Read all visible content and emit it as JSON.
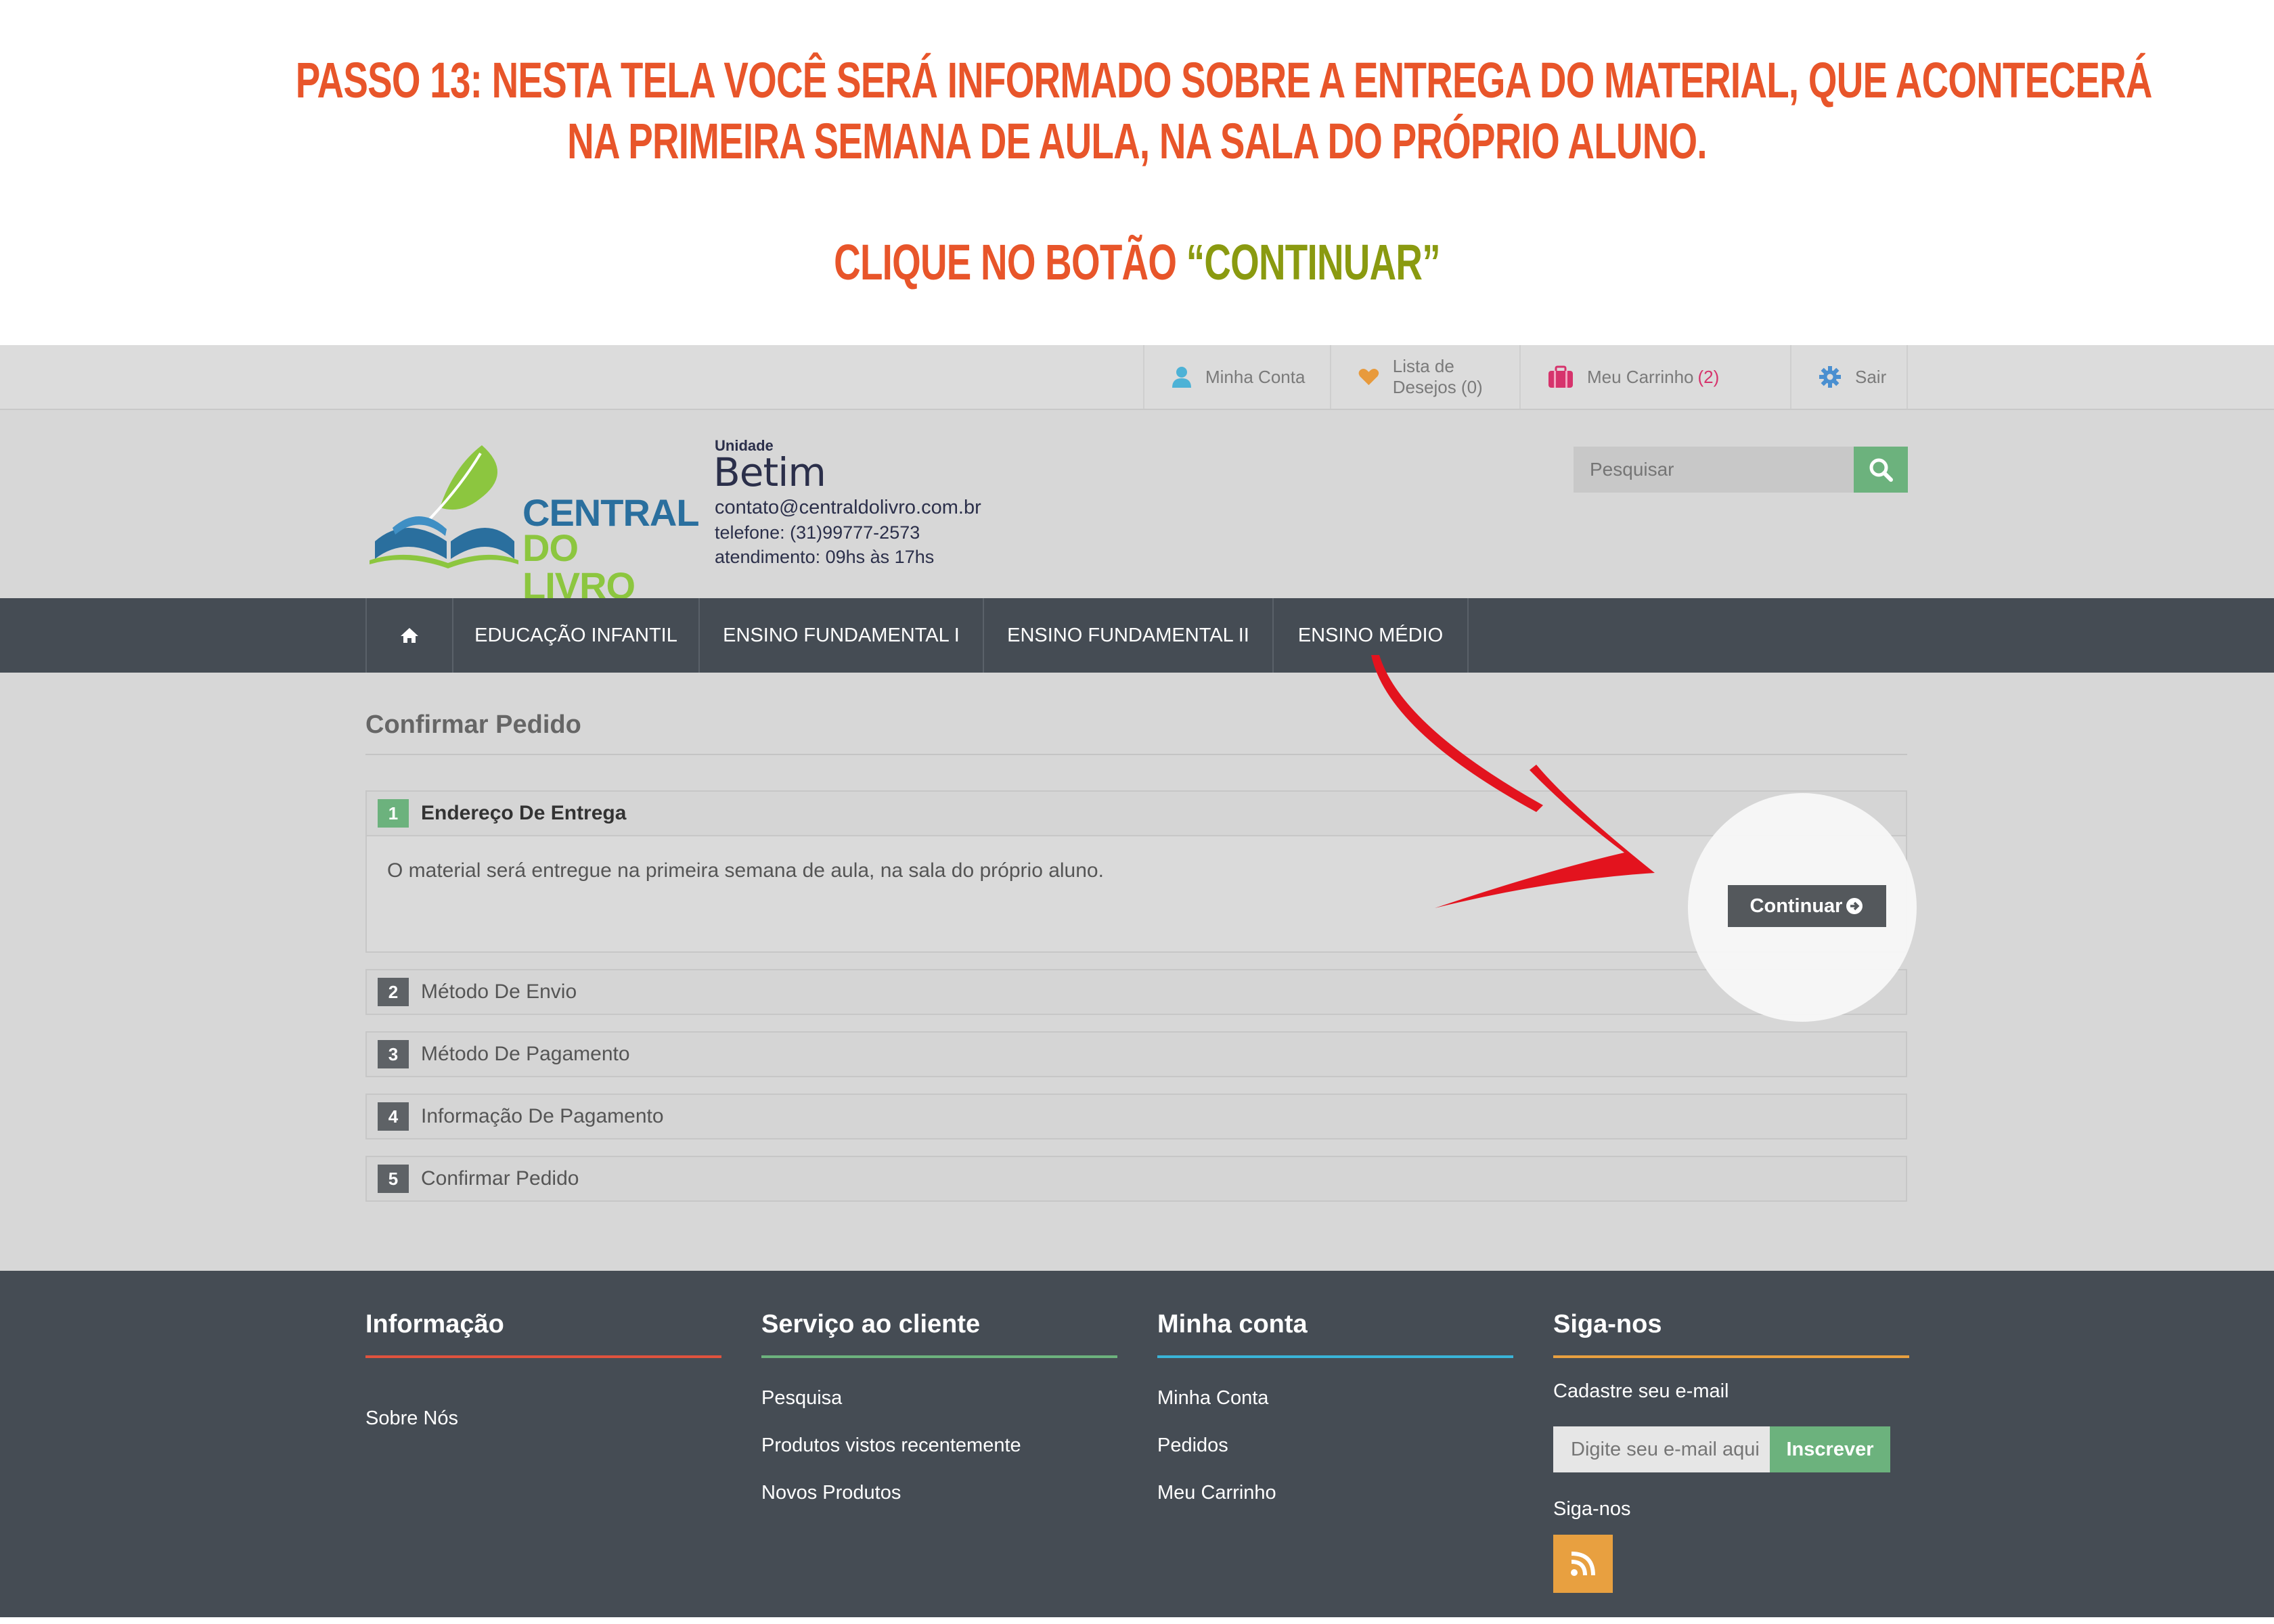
{
  "banner": {
    "line1": "PASSO 13: NESTA TELA VOCÊ SERÁ INFORMADO SOBRE A ENTREGA DO MATERIAL, QUE ACONTECERÁ",
    "line2": "NA PRIMEIRA SEMANA DE AULA, NA SALA DO PRÓPRIO ALUNO.",
    "line3_prefix": "CLIQUE NO BOTÃO ",
    "line3_highlight": "“CONTINUAR”"
  },
  "topbar": {
    "account": "Minha Conta",
    "wishlist": "Lista de Desejos (0)",
    "cart": "Meu Carrinho",
    "cart_count": "(2)",
    "logout": "Sair"
  },
  "logo": {
    "line1": "CENTRAL",
    "line2": "DO LIVRO"
  },
  "store": {
    "unit_label": "Unidade",
    "unit_name": "Betim",
    "email": "contato@centraldolivro.com.br",
    "phone": "telefone: (31)99777-2573",
    "hours": "atendimento: 09hs às 17hs"
  },
  "search": {
    "placeholder": "Pesquisar"
  },
  "nav": [
    "EDUCAÇÃO INFANTIL",
    "ENSINO FUNDAMENTAL I",
    "ENSINO FUNDAMENTAL II",
    "ENSINO MÉDIO"
  ],
  "checkout": {
    "title": "Confirmar Pedido",
    "steps": [
      {
        "num": "1",
        "label": "Endereço De Entrega"
      },
      {
        "num": "2",
        "label": "Método De Envio"
      },
      {
        "num": "3",
        "label": "Método De Pagamento"
      },
      {
        "num": "4",
        "label": "Informação De Pagamento"
      },
      {
        "num": "5",
        "label": "Confirmar Pedido"
      }
    ],
    "message": "O material será entregue na primeira semana de aula, na sala do próprio aluno.",
    "continue_label": "Continuar"
  },
  "footer": {
    "info_title": "Informação",
    "info_links": [
      "Sobre Nós"
    ],
    "service_title": "Serviço ao cliente",
    "service_links": [
      "Pesquisa",
      "Produtos vistos recentemente",
      "Novos Produtos"
    ],
    "account_title": "Minha conta",
    "account_links": [
      "Minha Conta",
      "Pedidos",
      "Meu Carrinho"
    ],
    "follow_title": "Siga-nos",
    "newsletter_label": "Cadastre seu e-mail",
    "newsletter_placeholder": "Digite seu e-mail aqui",
    "subscribe_label": "Inscrever",
    "follow_label": "Siga-nos"
  },
  "colors": {
    "banner_orange": "#e8552a",
    "banner_green": "#8a9a10",
    "nav_bg": "#454c54",
    "green_accent": "#6cb27d",
    "arrow_red": "#e3131e",
    "rss_orange": "#e8a040"
  }
}
